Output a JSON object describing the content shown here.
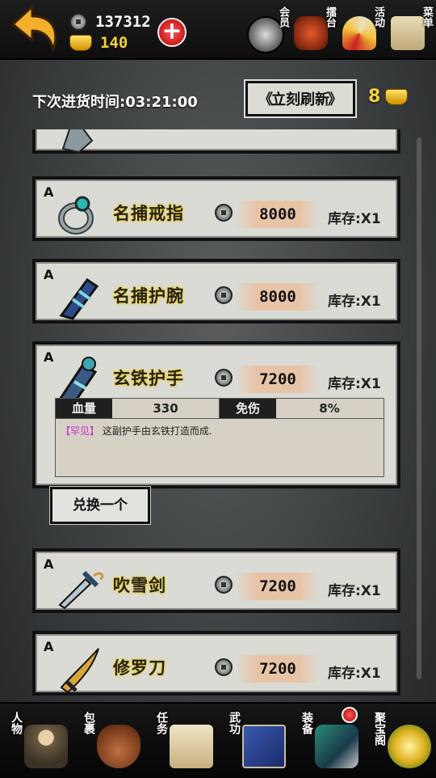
{
  "header": {
    "silver": "137312",
    "gold": "140",
    "menu": [
      {
        "label": "会员",
        "icon": "vip-coin-icon"
      },
      {
        "label": "擂台",
        "icon": "arena-drum-icon"
      },
      {
        "label": "活动",
        "icon": "event-fan-icon"
      },
      {
        "label": "菜单",
        "icon": "menu-scroll-icon"
      }
    ]
  },
  "shop": {
    "next_restock": "下次进货时间:03:21:00",
    "refresh_label": "立刻刷新",
    "gold_count": "8",
    "exchange_label": "兑换一个",
    "items": [
      {
        "grade": "A",
        "name": "名捕戒指",
        "price": "8000",
        "stock": "库存:X1",
        "icon": "ring-icon"
      },
      {
        "grade": "A",
        "name": "名捕护腕",
        "price": "8000",
        "stock": "库存:X1",
        "icon": "bracer-icon"
      },
      {
        "grade": "A",
        "name": "玄铁护手",
        "price": "7200",
        "stock": "库存:X1",
        "icon": "gauntlet-icon",
        "detail": {
          "stat1_label": "血量",
          "stat1_value": "330",
          "stat2_label": "免伤",
          "stat2_value": "8%",
          "rarity": "【罕见】",
          "desc": "这副护手由玄铁打造而成."
        }
      },
      {
        "grade": "A",
        "name": "吹雪剑",
        "price": "7200",
        "stock": "库存:X1",
        "icon": "sword-icon"
      },
      {
        "grade": "A",
        "name": "修罗刀",
        "price": "7200",
        "stock": "库存:X1",
        "icon": "saber-icon"
      }
    ]
  },
  "bottom_nav": [
    {
      "label": "人物",
      "icon": "character-icon"
    },
    {
      "label": "包裹",
      "icon": "bag-icon"
    },
    {
      "label": "任务",
      "icon": "quest-scroll-icon"
    },
    {
      "label": "武功",
      "icon": "martial-book-icon"
    },
    {
      "label": "装备",
      "icon": "equipment-icon"
    },
    {
      "label": "聚宝阁",
      "icon": "treasure-icon"
    }
  ]
}
